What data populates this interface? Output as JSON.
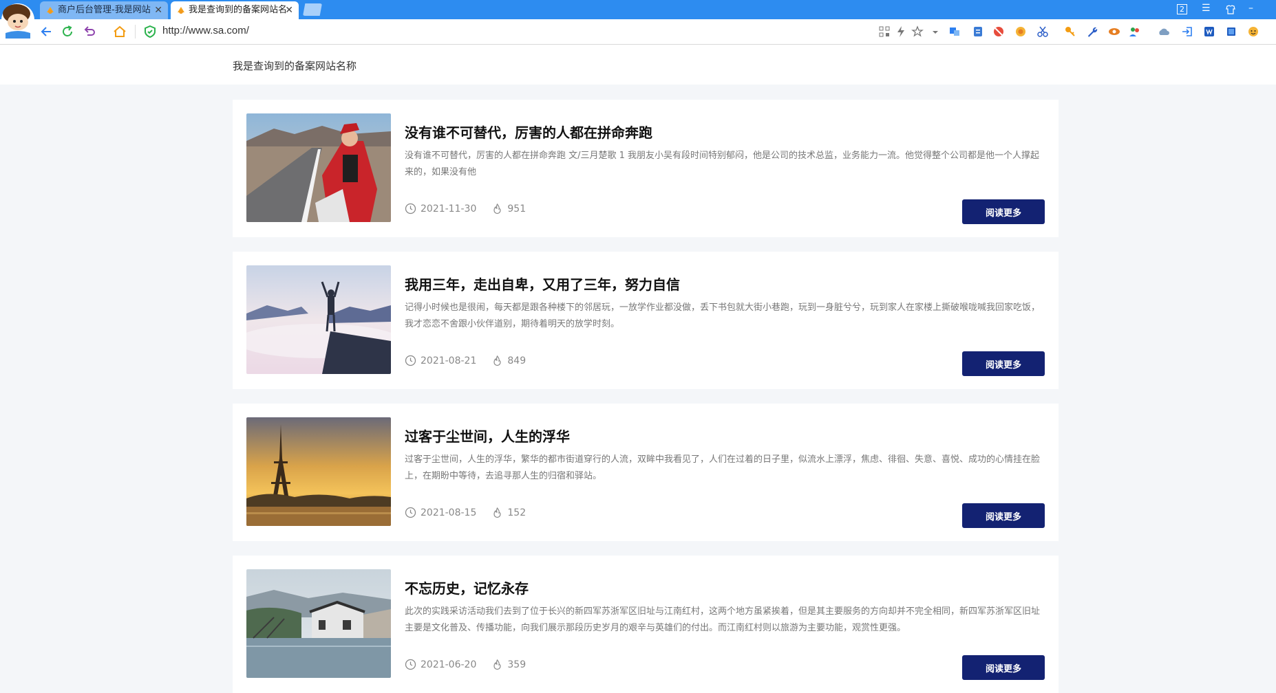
{
  "browser": {
    "tabs": [
      {
        "label": "商户后台管理-我是网站",
        "active": false
      },
      {
        "label": "我是查询到的备案网站名",
        "active": true
      }
    ],
    "tab_close_glyph": "✕",
    "url": "http://www.sa.com/",
    "window_badge": "2",
    "window_controls": [
      "☰",
      "–"
    ]
  },
  "site": {
    "title": "我是查询到的备案网站名称"
  },
  "articles": [
    {
      "title": "没有谁不可替代，厉害的人都在拼命奔跑",
      "excerpt": "没有谁不可替代，厉害的人都在拼命奔跑 文/三月楚歌 1 我朋友小吴有段时间特别郁闷，他是公司的技术总监，业务能力一流。他觉得整个公司都是他一个人撑起来的，如果没有他",
      "date": "2021-11-30",
      "views": "951",
      "button": "阅读更多",
      "image": "woman-on-road"
    },
    {
      "title": "我用三年，走出自卑，又用了三年，努力自信",
      "excerpt": "记得小时候也是很闹，每天都是跟各种楼下的邻居玩，一放学作业都没做，丢下书包就大街小巷跑，玩到一身脏兮兮，玩到家人在家楼上撕破喉咙喊我回家吃饭，我才恋恋不舍跟小伙伴道别，期待着明天的放学时刻。",
      "date": "2021-08-21",
      "views": "849",
      "button": "阅读更多",
      "image": "person-on-cliff"
    },
    {
      "title": "过客于尘世间，人生的浮华",
      "excerpt": "过客于尘世间，人生的浮华，繁华的都市街道穿行的人流，双眸中我看见了，人们在过着的日子里，似流水上漂浮，焦虑、徘徊、失意、喜悦、成功的心情挂在脸上，在期盼中等待，去追寻那人生的归宿和驿站。",
      "date": "2021-08-15",
      "views": "152",
      "button": "阅读更多",
      "image": "eiffel-tower-sunset"
    },
    {
      "title": "不忘历史，记忆永存",
      "excerpt": "此次的实践采访活动我们去到了位于长兴的新四军苏浙军区旧址与江南红村，这两个地方虽紧挨着，但是其主要服务的方向却并不完全相同，新四军苏浙军区旧址主要是文化普及、传播功能，向我们展示那段历史岁月的艰辛与英雄们的付出。而江南红村则以旅游为主要功能，观赏性更强。",
      "date": "2021-06-20",
      "views": "359",
      "button": "阅读更多",
      "image": "water-village"
    }
  ],
  "colors": {
    "tabbar": "#2d8cf0",
    "button": "#132272",
    "page_bg": "#f4f6f9"
  }
}
